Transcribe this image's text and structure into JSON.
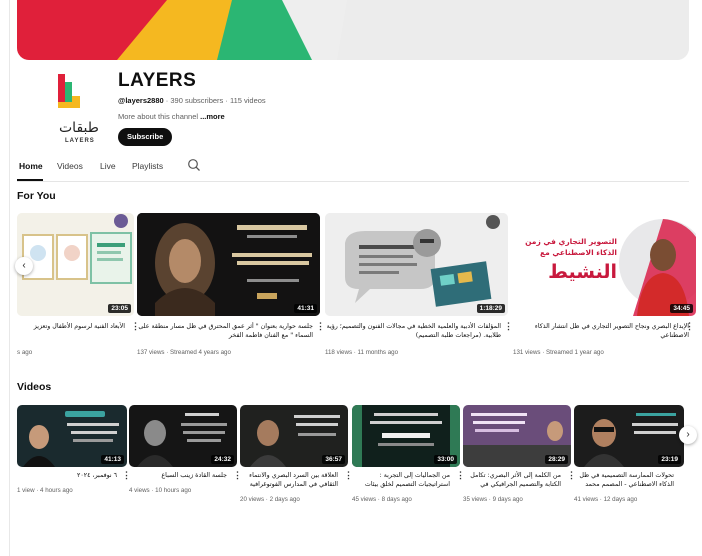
{
  "channel": {
    "name": "LAYERS",
    "handle": "@layers2880",
    "meta_rest": " · 390 subscribers · 115 videos",
    "about_prefix": "More about this channel ",
    "about_more": "...more",
    "subscribe_label": "Subscribe",
    "logo_arabic": "طبقات",
    "logo_latin": "LAYERS"
  },
  "tabs": [
    "Home",
    "Videos",
    "Live",
    "Playlists"
  ],
  "for_you": {
    "title": "For You",
    "cards": [
      {
        "duration": "23:05",
        "title": "الأبعاد الفنية لرسوم الأطفال وتعزيز الهوية",
        "meta": "s ago"
      },
      {
        "duration": "41:31",
        "title": "جلسة حوارية بعنوان \" أثر عمق المحترق في ظل مسار منطقة على السماء \" مع الفنان فاطمة الفخر",
        "meta": "137 views · Streamed 4 years ago"
      },
      {
        "duration": "1:18:29",
        "title": "المؤلفات الأدبية والعلمية الخطية في مجالات الفنون والتصميم؛ رؤية طلابية. (مراجعات طلبة التصميم)",
        "meta": "118 views · 11 months ago"
      },
      {
        "duration": "34:45",
        "title": "الإبداع البصري ونجاح التصوير التجاري في ظل انتشار الذكاء الاصطناعي",
        "meta": "131 views · Streamed 1 year ago"
      }
    ]
  },
  "videos": {
    "title": "Videos",
    "cards": [
      {
        "duration": "41:13",
        "title": "٦ نوفمبر، ٢٠٢٤",
        "meta": "1 view · 4 hours ago"
      },
      {
        "duration": "24:32",
        "title": "جلسة القادة زينب السباع",
        "meta": "4 views · 10 hours ago"
      },
      {
        "duration": "36:57",
        "title": "العلاقة بين السرد البصري والانتماء الثقافي في المدارس الفوتوغرافية",
        "meta": "20 views · 2 days ago"
      },
      {
        "duration": "33:00",
        "title": "من الجماليات إلى التجربة : استراتيجيات التصميم لخلق بيئات مؤثرة وجذابة",
        "meta": "45 views · 8 days ago"
      },
      {
        "duration": "28:29",
        "title": "من الكلمة إلى الأثر البصري: تكامل الكتابة والتصميم الجرافيكي في المدارس",
        "meta": "35 views · 9 days ago"
      },
      {
        "duration": "23:19",
        "title": "تحولات الممارسة التصميمية في ظل الذكاء الاصطناعي - المصمم محمد مسعود",
        "meta": "41 views · 12 days ago"
      }
    ]
  },
  "thumb_texts": {
    "nashat_line1": "التصوير التجاري في زمن",
    "nashat_line2": "الذكاء الاصطناعي مع",
    "nashat_big": "النشيط"
  },
  "icons": {
    "search": "search-icon",
    "prev": "chevron-left-icon",
    "next": "chevron-right-icon",
    "more": "more-vert-icon"
  },
  "colors": {
    "subscribe_bg": "#0f0f0f",
    "muted": "#606060",
    "logo_red": "#e0203a",
    "logo_green": "#2bb673",
    "logo_yellow": "#f5b820"
  }
}
